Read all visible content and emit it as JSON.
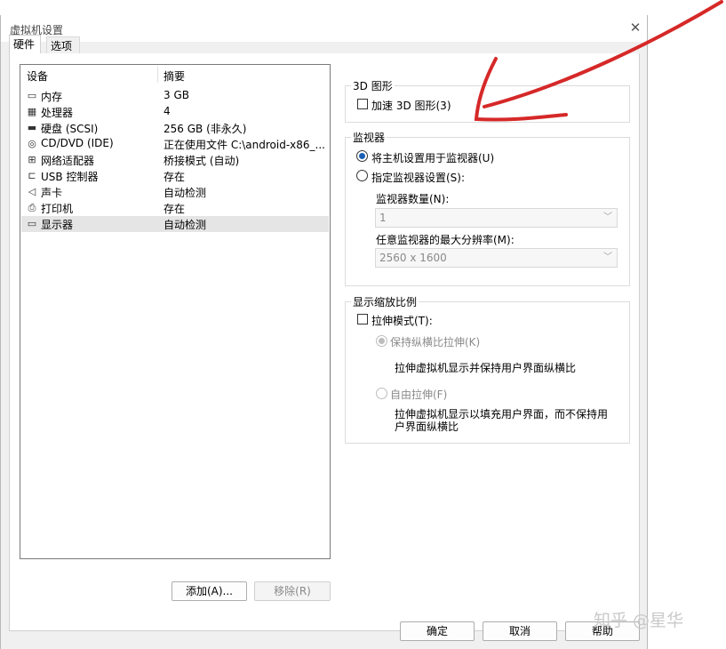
{
  "window": {
    "title": "虚拟机设置",
    "close_glyph": "✕"
  },
  "tabs": [
    {
      "label": "硬件",
      "active": true
    },
    {
      "label": "选项",
      "active": false
    }
  ],
  "device_list": {
    "headers": {
      "device": "设备",
      "summary": "摘要"
    },
    "items": [
      {
        "icon": "memory-icon",
        "glyph": "▭",
        "device": "内存",
        "summary": "3 GB"
      },
      {
        "icon": "processor-icon",
        "glyph": "▦",
        "device": "处理器",
        "summary": "4"
      },
      {
        "icon": "hard-disk-icon",
        "glyph": "▬",
        "device": "硬盘 (SCSI)",
        "summary": "256 GB (非永久)"
      },
      {
        "icon": "cd-dvd-icon",
        "glyph": "◎",
        "device": "CD/DVD (IDE)",
        "summary": "正在使用文件 C:\\android-x86_..."
      },
      {
        "icon": "network-adapter-icon",
        "glyph": "⊞",
        "device": "网络适配器",
        "summary": "桥接模式 (自动)"
      },
      {
        "icon": "usb-icon",
        "glyph": "⊏",
        "device": "USB 控制器",
        "summary": "存在"
      },
      {
        "icon": "sound-card-icon",
        "glyph": "◁",
        "device": "声卡",
        "summary": "自动检测"
      },
      {
        "icon": "printer-icon",
        "glyph": "⎙",
        "device": "打印机",
        "summary": "存在"
      },
      {
        "icon": "display-icon",
        "glyph": "▭",
        "device": "显示器",
        "summary": "自动检测",
        "selected": true
      }
    ]
  },
  "buttons": {
    "add": "添加(A)...",
    "remove": "移除(R)",
    "ok": "确定",
    "cancel": "取消",
    "help": "帮助"
  },
  "graphics3d": {
    "legend": "3D 图形",
    "accelerate_label": "加速 3D 图形(3)",
    "accelerate_checked": false
  },
  "monitor": {
    "legend": "监视器",
    "use_host_label": "将主机设置用于监视器(U)",
    "specify_label": "指定监视器设置(S):",
    "selected": "use_host",
    "count_label": "监视器数量(N):",
    "count_value": "1",
    "resolution_label": "任意监视器的最大分辨率(M):",
    "resolution_value": "2560 x 1600"
  },
  "scaling": {
    "legend": "显示缩放比例",
    "stretch_label": "拉伸模式(T):",
    "stretch_checked": false,
    "keep_ratio_label": "保持纵横比拉伸(K)",
    "keep_ratio_desc": "拉伸虚拟机显示并保持用户界面纵横比",
    "free_label": "自由拉伸(F)",
    "free_desc_line1": "拉伸虚拟机显示以填充用户界面，而不保持用",
    "free_desc_line2": "户界面纵横比"
  },
  "watermark": "知乎 @星华",
  "colors": {
    "annotation_red": "#d62828",
    "radio_accent": "#1a5fb4",
    "selection": "#e5e5e5"
  }
}
